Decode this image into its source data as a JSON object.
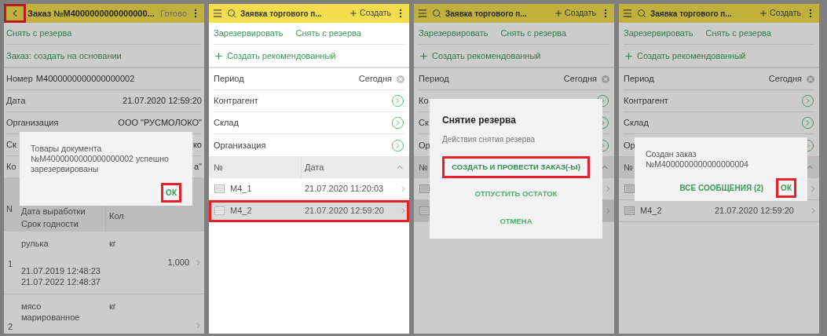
{
  "screens": [
    {
      "kind": "document",
      "dimmed": true,
      "header": {
        "title": "Заказ №М4000000000000000...",
        "action": "Готово",
        "back_highlighted": true
      },
      "commands": [
        {
          "label": "Снять с резерва"
        },
        {
          "label": "Заказ: создать на основании"
        }
      ],
      "fields": [
        {
          "label": "Номер",
          "value": "М4000000000000000002",
          "kind": "inline"
        },
        {
          "label": "Дата",
          "value": "21.07.2020 12:59:20",
          "kind": "split"
        },
        {
          "label": "Организация",
          "value": "ООО \"РУСМОЛОКО\"",
          "kind": "split"
        },
        {
          "label": "Ск",
          "value": "ко",
          "kind": "split"
        },
        {
          "label": "Ко",
          "value": "а\"",
          "kind": "split"
        }
      ],
      "table": {
        "columns": [
          "N",
          "Дата выработки",
          "Срок годности",
          "Кол"
        ],
        "rows": [
          {
            "number": "1",
            "name": "рулька",
            "dates": [
              "21.07.2019 12:48:23",
              "21.07.2022 12:48:37"
            ],
            "unit": "кг",
            "quantity": "1,000"
          },
          {
            "number": "2",
            "name": "мясо марированное",
            "unit": "кг"
          }
        ]
      },
      "dialog": {
        "kind": "message",
        "text": "Товары документа №М4000000000000000002 успешно зарезервированы",
        "buttons": [
          {
            "label": "ОК",
            "highlighted": true
          }
        ]
      }
    },
    {
      "kind": "list",
      "dimmed": false,
      "header": {
        "title": "Заявка торгового п...",
        "create": "Создать"
      },
      "commands": [
        {
          "label": "Зарезервировать"
        },
        {
          "label": "Снять с резерва"
        }
      ],
      "recommended": "Создать рекомендованный",
      "filters": [
        {
          "label": "Период",
          "value": "Сегодня",
          "kind": "clearable"
        },
        {
          "label": "Контрагент",
          "kind": "select"
        },
        {
          "label": "Склад",
          "kind": "select"
        },
        {
          "label": "Организация",
          "kind": "select"
        }
      ],
      "table": {
        "columns": [
          "№",
          "Дата"
        ],
        "rows": [
          {
            "number": "М4_1",
            "date": "21.07.2020 11:20:03",
            "selected": false,
            "highlighted": false
          },
          {
            "number": "М4_2",
            "date": "21.07.2020 12:59:20",
            "selected": true,
            "highlighted": true
          }
        ]
      }
    },
    {
      "kind": "list",
      "dimmed": true,
      "header": {
        "title": "Заявка торгового п...",
        "create": "Создать"
      },
      "commands": [
        {
          "label": "Зарезервировать"
        },
        {
          "label": "Снять с резерва"
        }
      ],
      "recommended": "Создать рекомендованный",
      "filters": [
        {
          "label": "Период",
          "value": "Сегодня",
          "kind": "clearable"
        },
        {
          "label": "Ко",
          "kind": "select"
        },
        {
          "label": "Ск",
          "kind": "select"
        },
        {
          "label": "Ор",
          "kind": "select"
        }
      ],
      "table": {
        "columns": [
          "№"
        ],
        "rows": [
          {
            "selected": false,
            "highlighted": false
          },
          {
            "selected": true,
            "highlighted": false
          }
        ]
      },
      "dialog": {
        "kind": "actions",
        "title": "Снятие резерва",
        "text": "Действия снятия резерва",
        "buttons": [
          {
            "label": "СОЗДАТЬ И ПРОВЕСТИ ЗАКАЗ(-Ы)",
            "highlighted": true
          },
          {
            "label": "ОТПУСТИТЬ ОСТАТОК",
            "highlighted": false
          },
          {
            "label": "ОТМЕНА",
            "highlighted": false
          }
        ]
      }
    },
    {
      "kind": "list",
      "dimmed": true,
      "header": {
        "title": "Заявка торгового п...",
        "create": "Создать"
      },
      "commands": [
        {
          "label": "Зарезервировать"
        },
        {
          "label": "Снять с резерва"
        }
      ],
      "recommended": "Создать рекомендованный",
      "filters": [
        {
          "label": "Период",
          "value": "Сегодня",
          "kind": "clearable"
        },
        {
          "label": "Контрагент",
          "kind": "select"
        },
        {
          "label": "Склад",
          "kind": "select"
        },
        {
          "label": "Ор",
          "kind": "select"
        }
      ],
      "table": {
        "columns": [
          "№"
        ],
        "rows": [
          {
            "selected": false,
            "highlighted": false
          },
          {
            "number": "М4_2",
            "date": "21.07.2020 12:59:20",
            "selected": false,
            "highlighted": false
          }
        ]
      },
      "dialog": {
        "kind": "message",
        "text": "Создан заказ №М4000000000000000004",
        "buttons": [
          {
            "label": "ВСЕ СООБЩЕНИЯ (2)",
            "highlighted": false
          },
          {
            "label": "ОК",
            "highlighted": true
          }
        ]
      }
    }
  ]
}
